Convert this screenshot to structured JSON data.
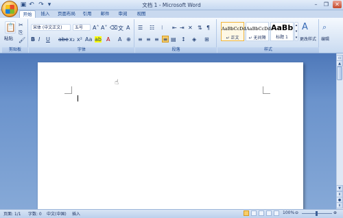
{
  "window": {
    "title": "文档 1 - Microsoft Word"
  },
  "tabs": [
    "开始",
    "插入",
    "页面布局",
    "引用",
    "邮件",
    "审阅",
    "视图"
  ],
  "clipboard": {
    "paste_label": "粘贴",
    "group_label": "剪贴板"
  },
  "font": {
    "name": "宋体 (中文正文)",
    "size": "五号",
    "group_label": "字体"
  },
  "paragraph": {
    "group_label": "段落"
  },
  "styles": {
    "items": [
      {
        "sample": "AaBbCcDd",
        "name": "↵ 正文"
      },
      {
        "sample": "AaBbCcDd",
        "name": "↵ 无间隔"
      },
      {
        "sample": "AaBb",
        "name": "标题 1"
      }
    ],
    "change_label": "更改样式",
    "group_label": "样式"
  },
  "editing": {
    "label": "编辑"
  },
  "status": {
    "page": "页面: 1/1",
    "words": "字数: 0",
    "language": "中文(中国)",
    "mode": "插入",
    "zoom": "100%"
  }
}
